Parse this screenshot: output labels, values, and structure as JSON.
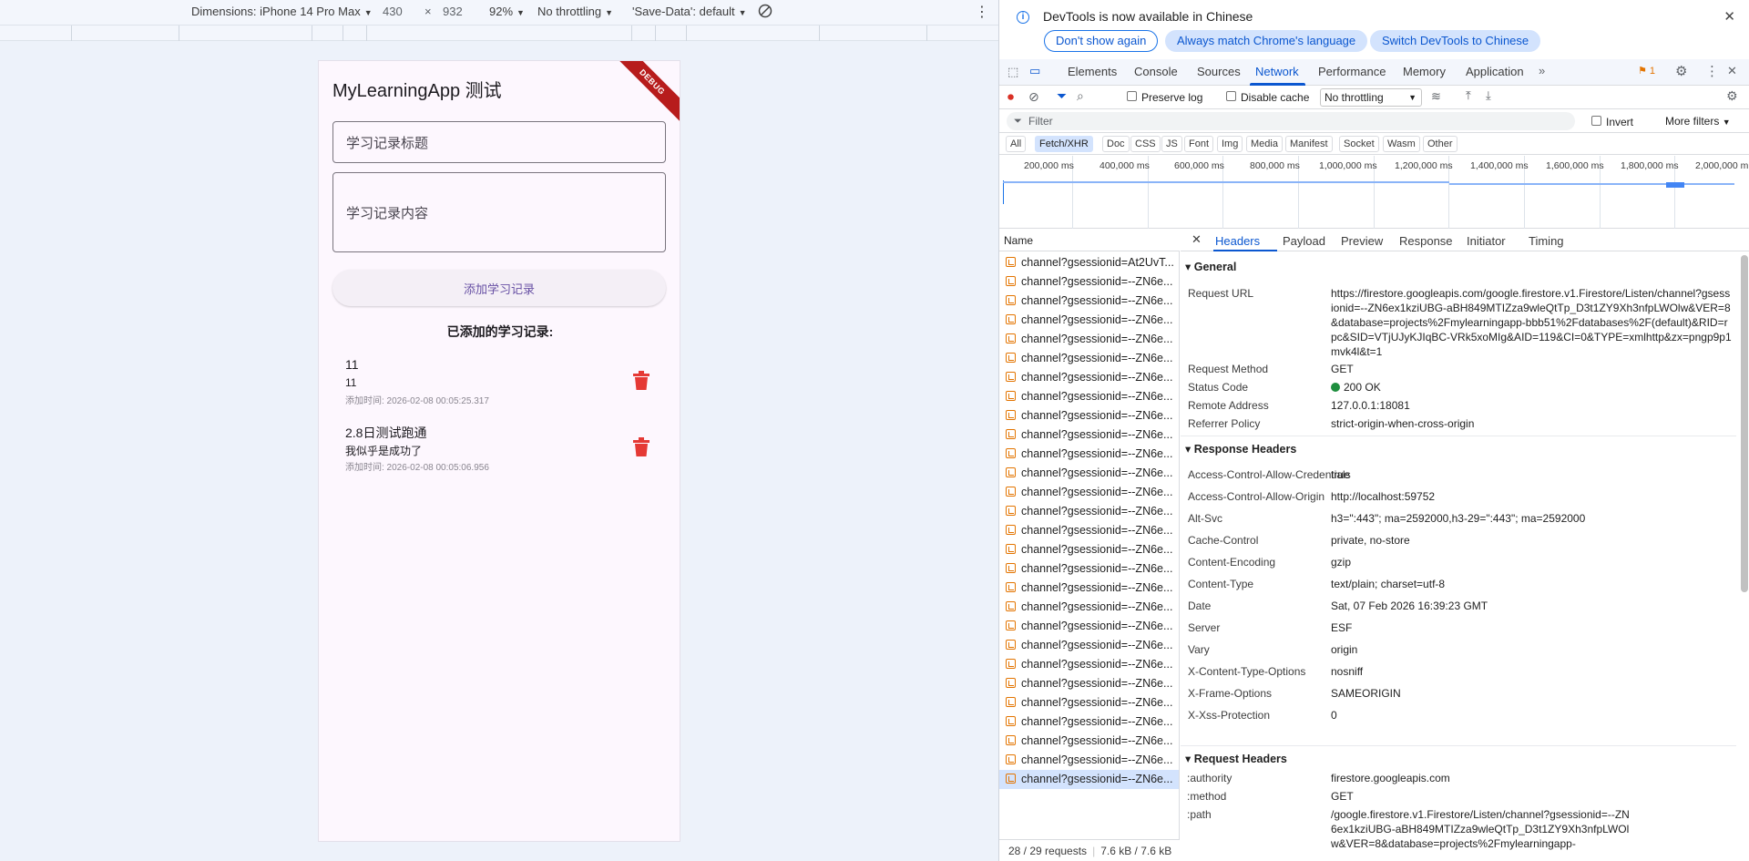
{
  "emulation": {
    "dimensions_label": "Dimensions: iPhone 14 Pro Max",
    "width": "430",
    "times": "×",
    "height": "932",
    "zoom": "92%",
    "throttling": "No throttling",
    "save_data": "'Save-Data': default"
  },
  "app": {
    "title": "MyLearningApp 测试",
    "debug_banner": "DEBUG",
    "title_placeholder": "学习记录标题",
    "content_placeholder": "学习记录内容",
    "add_button": "添加学习记录",
    "list_heading": "已添加的学习记录:",
    "records": [
      {
        "title": "11",
        "content": "11",
        "time": "添加时间: 2026-02-08 00:05:25.317"
      },
      {
        "title": "2.8日测试跑通",
        "content": "我似乎是成功了",
        "time": "添加时间: 2026-02-08 00:05:06.956"
      }
    ],
    "delete_color": "#e53935"
  },
  "infobar": {
    "message": "DevTools is now available in Chinese",
    "dont_show": "Don't show again",
    "match_language": "Always match Chrome's language",
    "switch_language": "Switch DevTools to Chinese"
  },
  "devtools_tabs": [
    "Elements",
    "Console",
    "Sources",
    "Network",
    "Performance",
    "Memory",
    "Application"
  ],
  "issues_count": "1",
  "network_toolbar": {
    "preserve_log": "Preserve log",
    "disable_cache": "Disable cache",
    "throttling": "No throttling"
  },
  "filter": {
    "placeholder": "Filter",
    "invert": "Invert",
    "more_filters": "More filters"
  },
  "type_filters": [
    "All",
    "Fetch/XHR",
    "Doc",
    "CSS",
    "JS",
    "Font",
    "Img",
    "Media",
    "Manifest",
    "Socket",
    "Wasm",
    "Other"
  ],
  "overview_ticks": [
    "200,000 ms",
    "400,000 ms",
    "600,000 ms",
    "800,000 ms",
    "1,000,000 ms",
    "1,200,000 ms",
    "1,400,000 ms",
    "1,600,000 ms",
    "1,800,000 ms",
    "2,000,000 m"
  ],
  "request_list": {
    "header": "Name",
    "first": "channel?gsessionid=At2UvT...",
    "rest": "channel?gsessionid=--ZN6e...",
    "rest_count": 27,
    "status": "28 / 29 requests",
    "size": "7.6 kB / 7.6 kB"
  },
  "detail_tabs": [
    "Headers",
    "Payload",
    "Preview",
    "Response",
    "Initiator",
    "Timing"
  ],
  "general": {
    "heading": "General",
    "request_url_key": "Request URL",
    "request_url": "https://firestore.googleapis.com/google.firestore.v1.Firestore/Listen/channel?gsessionid=--ZN6ex1kziUBG-aBH849MTIZza9wleQtTp_D3t1ZY9Xh3nfpLWOlw&VER=8&database=projects%2Fmylearningapp-bbb51%2Fdatabases%2F(default)&RID=rpc&SID=VTjUJyKJIqBC-VRk5xoMIg&AID=119&CI=0&TYPE=xmlhttp&zx=pngp9p1mvk4l&t=1",
    "request_method_key": "Request Method",
    "request_method": "GET",
    "status_code_key": "Status Code",
    "status_code": "200 OK",
    "remote_address_key": "Remote Address",
    "remote_address": "127.0.0.1:18081",
    "referrer_policy_key": "Referrer Policy",
    "referrer_policy": "strict-origin-when-cross-origin"
  },
  "response_headers": {
    "heading": "Response Headers",
    "items": [
      {
        "k": "Access-Control-Allow-Credentials",
        "v": "true"
      },
      {
        "k": "Access-Control-Allow-Origin",
        "v": "http://localhost:59752"
      },
      {
        "k": "Alt-Svc",
        "v": "h3=\":443\"; ma=2592000,h3-29=\":443\"; ma=2592000"
      },
      {
        "k": "Cache-Control",
        "v": "private, no-store"
      },
      {
        "k": "Content-Encoding",
        "v": "gzip"
      },
      {
        "k": "Content-Type",
        "v": "text/plain; charset=utf-8"
      },
      {
        "k": "Date",
        "v": "Sat, 07 Feb 2026 16:39:23 GMT"
      },
      {
        "k": "Server",
        "v": "ESF"
      },
      {
        "k": "Vary",
        "v": "origin"
      },
      {
        "k": "X-Content-Type-Options",
        "v": "nosniff"
      },
      {
        "k": "X-Frame-Options",
        "v": "SAMEORIGIN"
      },
      {
        "k": "X-Xss-Protection",
        "v": "0"
      }
    ]
  },
  "request_headers": {
    "heading": "Request Headers",
    "authority_key": ":authority",
    "authority": "firestore.googleapis.com",
    "method_key": ":method",
    "method": "GET",
    "path_key": ":path",
    "path": "/google.firestore.v1.Firestore/Listen/channel?gsessionid=--ZN6ex1kziUBG-aBH849MTIZza9wleQtTp_D3t1ZY9Xh3nfpLWOlw&VER=8&database=projects%2Fmylearningapp-"
  }
}
